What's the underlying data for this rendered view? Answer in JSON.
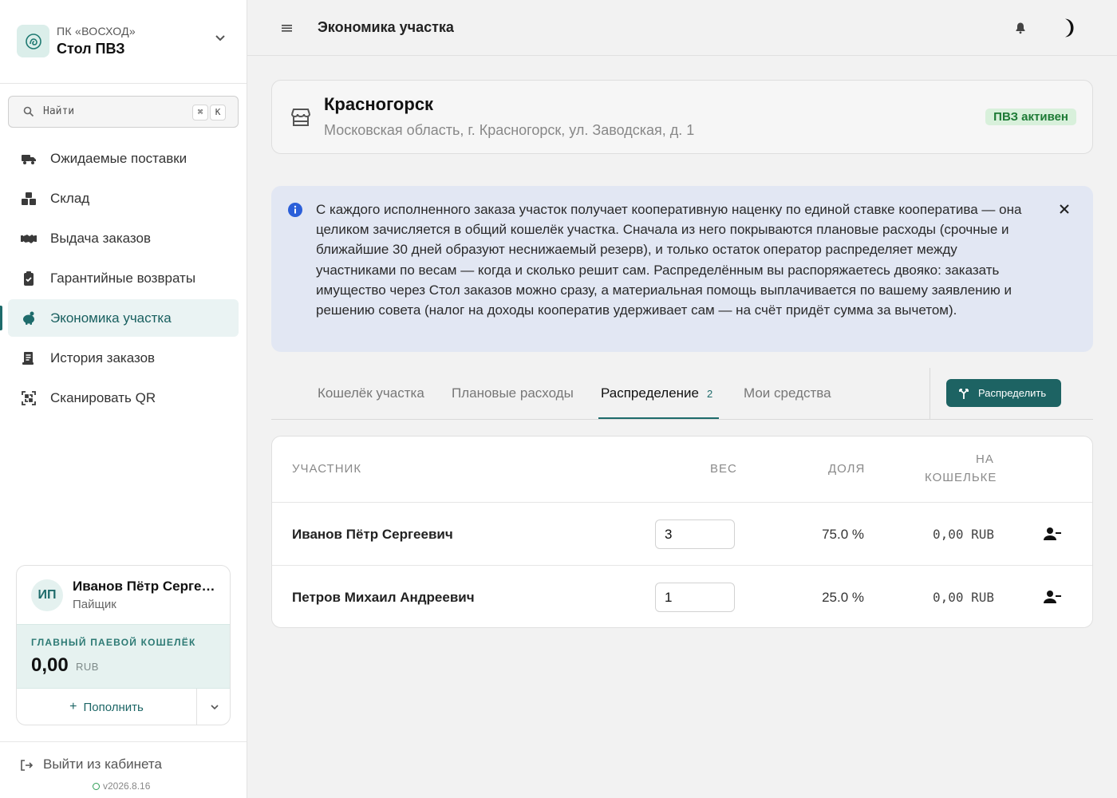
{
  "sidebar": {
    "org_subtitle": "ПК «ВОСХОД»",
    "org_name": "Стол ПВЗ",
    "search_placeholder": "Найти",
    "search_shortcut_keys": [
      "⌘",
      "K"
    ],
    "items": [
      {
        "label": "Ожидаемые поставки",
        "icon": "truck-icon",
        "active": false
      },
      {
        "label": "Склад",
        "icon": "boxes-icon",
        "active": false
      },
      {
        "label": "Выдача заказов",
        "icon": "handshake-icon",
        "active": false
      },
      {
        "label": "Гарантийные возвраты",
        "icon": "clipboard-check-icon",
        "active": false
      },
      {
        "label": "Экономика участка",
        "icon": "piggy-bank-icon",
        "active": true
      },
      {
        "label": "История заказов",
        "icon": "receipt-icon",
        "active": false
      },
      {
        "label": "Сканировать QR",
        "icon": "qr-scan-icon",
        "active": false
      }
    ],
    "user": {
      "initials": "ИП",
      "name": "Иванов Пётр Сергеевич",
      "role": "Пайщик"
    },
    "wallet": {
      "title": "ГЛАВНЫЙ ПАЕВОЙ КОШЕЛЁК",
      "amount": "0,00",
      "currency": "RUB"
    },
    "topup_label": "Пополнить",
    "logout_label": "Выйти из кабинета",
    "version": "v2026.8.16"
  },
  "header": {
    "title": "Экономика участка"
  },
  "store": {
    "name": "Красногорск",
    "address": "Московская область, г. Красногорск, ул. Заводская, д. 1",
    "status": "ПВЗ активен"
  },
  "info": {
    "text": "С каждого исполненного заказа участок получает кооперативную наценку по единой ставке кооператива — она целиком зачисляется в общий кошелёк участка. Сначала из него покрываются плановые расходы (срочные и ближайшие 30 дней образуют неснижаемый резерв), и только остаток оператор распределяет между участниками по весам — когда и сколько решит сам. Распределённым вы распоряжаетесь двояко: заказать имущество через Стол заказов можно сразу, а материальная помощь выплачивается по вашему заявлению и решению совета (налог на доходы кооператив удерживает сам — на счёт придёт сумма за вычетом)."
  },
  "tabs": {
    "items": [
      {
        "label": "Кошелёк участка"
      },
      {
        "label": "Плановые расходы"
      },
      {
        "label": "Распределение",
        "count": "2"
      },
      {
        "label": "Мои средства"
      }
    ],
    "active_index": 2,
    "action_label": "Распределить"
  },
  "table": {
    "headers": {
      "participant": "УЧАСТНИК",
      "weight": "ВЕС",
      "share": "ДОЛЯ",
      "wallet_line1": "НА",
      "wallet_line2": "КОШЕЛЬКЕ"
    },
    "rows": [
      {
        "name": "Иванов Пётр Сергеевич",
        "weight": "3",
        "share": "75.0 %",
        "amount": "0,00 RUB"
      },
      {
        "name": "Петров Михаил Андреевич",
        "weight": "1",
        "share": "25.0 %",
        "amount": "0,00 RUB"
      }
    ]
  },
  "colors": {
    "accent": "#1d6363",
    "active_nav_bg": "#eaf3f3",
    "info_bg": "#e2e7f3",
    "badge_bg": "#d8f0db",
    "badge_text": "#1d7a35"
  }
}
